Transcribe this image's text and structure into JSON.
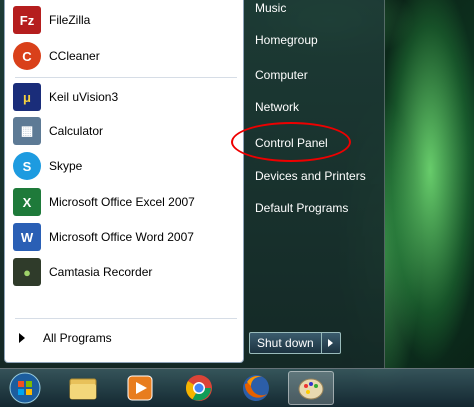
{
  "start_menu": {
    "programs": [
      {
        "label": "FileZilla",
        "icon": "filezilla-icon",
        "color": "#b51e1e",
        "glyph": "Fz"
      },
      {
        "label": "CCleaner",
        "icon": "ccleaner-icon",
        "color": "#d9401a",
        "glyph": "C"
      },
      {
        "label": "Keil uVision3",
        "icon": "keil-icon",
        "color": "#1a2d7a",
        "glyph": "μ"
      },
      {
        "label": "Calculator",
        "icon": "calculator-icon",
        "color": "#5d7a95",
        "glyph": "▦"
      },
      {
        "label": "Skype",
        "icon": "skype-icon",
        "color": "#1d9be0",
        "glyph": "S"
      },
      {
        "label": "Microsoft Office Excel 2007",
        "icon": "excel-icon",
        "color": "#1e7a3a",
        "glyph": "X"
      },
      {
        "label": "Microsoft Office Word 2007",
        "icon": "word-icon",
        "color": "#2a5fb5",
        "glyph": "W"
      },
      {
        "label": "Camtasia Recorder",
        "icon": "camtasia-icon",
        "color": "#2f3b2a",
        "glyph": "●"
      }
    ],
    "all_programs": "All Programs",
    "right_items": [
      "Music",
      "Homegroup",
      "Computer",
      "Network",
      "Control Panel",
      "Devices and Printers",
      "Default Programs"
    ],
    "shutdown_label": "Shut down"
  },
  "taskbar": {
    "items": [
      "start-orb-icon",
      "explorer-folder-icon",
      "media-player-icon",
      "chrome-icon",
      "firefox-icon",
      "paint-icon"
    ]
  },
  "colors": {
    "highlight": "#ee0000"
  }
}
